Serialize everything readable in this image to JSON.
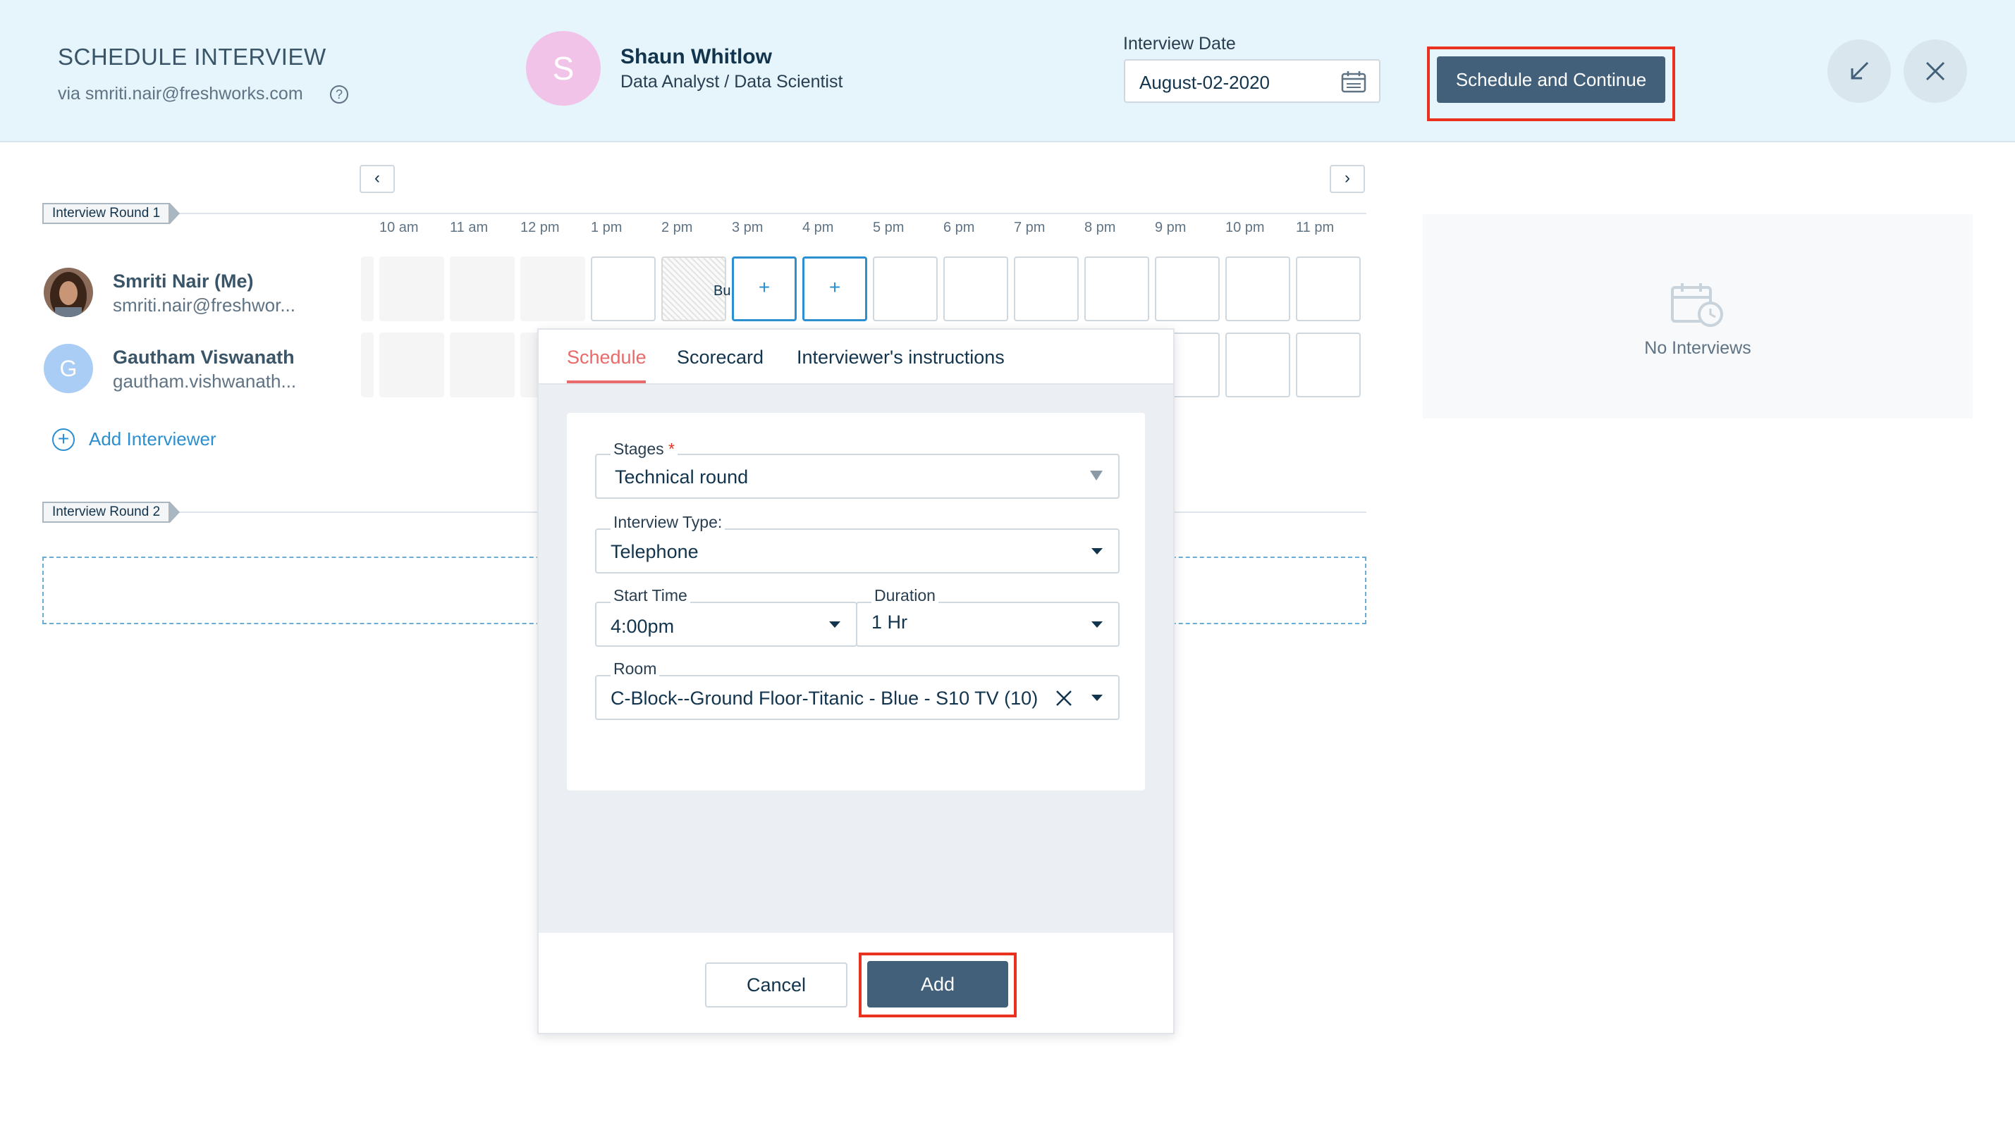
{
  "header": {
    "title": "SCHEDULE INTERVIEW",
    "via": "via smriti.nair@freshworks.com",
    "help_icon": "?",
    "candidate": {
      "initial": "S",
      "name": "Shaun Whitlow",
      "role": "Data Analyst / Data Scientist",
      "avatar_color": "#f2c3e8"
    },
    "date_label": "Interview Date",
    "date_value": "August-02-2020",
    "schedule_button": "Schedule and Continue",
    "minimize_icon": "minimize-arrow-icon",
    "close_icon": "close-icon"
  },
  "grid": {
    "prev_label": "‹",
    "next_label": "›",
    "hours": [
      "10 am",
      "11 am",
      "12 pm",
      "1 pm",
      "2 pm",
      "3 pm",
      "4 pm",
      "5 pm",
      "6 pm",
      "7 pm",
      "8 pm",
      "9 pm",
      "10 pm",
      "11 pm"
    ],
    "round1_label": "Interview Round 1",
    "round2_label": "Interview Round 2",
    "interviewers": [
      {
        "name": "Smriti Nair (Me)",
        "email": "smriti.nair@freshwor..."
      },
      {
        "name": "Gautham Viswanath",
        "email": "gautham.vishwanath...",
        "initial": "G"
      }
    ],
    "busy_label": "Bu",
    "slot_plus": "+",
    "add_interviewer": "Add Interviewer",
    "add_icon": "+"
  },
  "right_panel": {
    "empty_text": "No Interviews",
    "icon": "calendar-clock-icon"
  },
  "modal": {
    "tabs": [
      "Schedule",
      "Scorecard",
      "Interviewer's instructions"
    ],
    "active_tab": "Schedule",
    "fields": {
      "stages_label": "Stages",
      "stages_required": "*",
      "stages_value": "Technical round",
      "type_label": "Interview Type:",
      "type_value": "Telephone",
      "start_label": "Start Time",
      "start_value": "4:00pm",
      "duration_label": "Duration",
      "duration_value": "1 Hr",
      "room_label": "Room",
      "room_value": "C-Block--Ground Floor-Titanic - Blue - S10 TV (10)"
    },
    "cancel_button": "Cancel",
    "add_button": "Add"
  },
  "colors": {
    "accent": "#42607a",
    "highlight": "#e8321f",
    "active_tab": "#e86a6a",
    "link": "#2c8fd0"
  }
}
